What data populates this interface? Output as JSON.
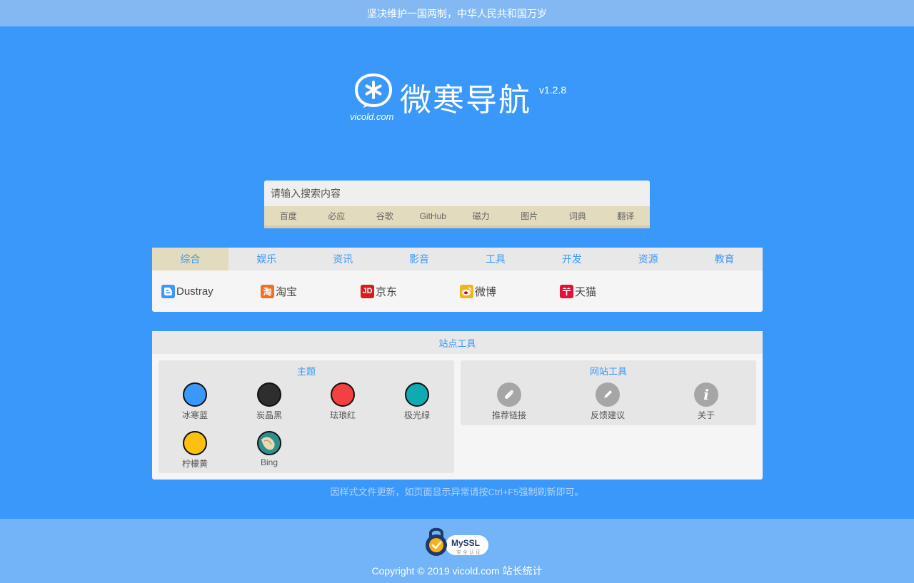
{
  "banner": {
    "text": "坚决维护一国两制，中华人民共和国万岁"
  },
  "logo": {
    "title": "微寒导航",
    "version": "v1.2.8",
    "domain": "vicold.com"
  },
  "search": {
    "placeholder": "请输入搜索内容",
    "engines": [
      "百度",
      "必应",
      "谷歌",
      "GitHub",
      "磁力",
      "图片",
      "词典",
      "翻译"
    ]
  },
  "nav": {
    "tabs": [
      "综合",
      "娱乐",
      "资讯",
      "影音",
      "工具",
      "开发",
      "资源",
      "教育"
    ],
    "active_tab": "综合",
    "sites": [
      {
        "label": "Dustray",
        "icon": "blogger-icon",
        "color": "#3a98fb"
      },
      {
        "label": "淘宝",
        "icon": "taobao-icon",
        "color": "#f07026"
      },
      {
        "label": "京东",
        "icon": "jd-icon",
        "color": "#d71c1e"
      },
      {
        "label": "微博",
        "icon": "weibo-icon",
        "color": "#f2b41c"
      },
      {
        "label": "天猫",
        "icon": "tmall-icon",
        "color": "#e2123a"
      }
    ],
    "site_icon_glyphs": {
      "taobao": "淘",
      "jd": "JD"
    }
  },
  "tools": {
    "title": "站点工具",
    "themes_title": "主题",
    "themes": [
      {
        "label": "冰寒蓝",
        "color": "#3a98fb"
      },
      {
        "label": "炭晶黑",
        "color": "#2e2e2e"
      },
      {
        "label": "珐琅红",
        "color": "#f24140"
      },
      {
        "label": "极光绿",
        "color": "#0eabb3"
      },
      {
        "label": "柠檬黄",
        "color": "#fcc10f"
      },
      {
        "label": "Bing",
        "color": "#2f8f8a"
      }
    ],
    "site_tools_title": "网站工具",
    "site_tools": [
      {
        "label": "推荐链接",
        "icon": "paperclip-icon"
      },
      {
        "label": "反馈建议",
        "icon": "pencil-icon"
      },
      {
        "label": "关于",
        "icon": "info-icon"
      }
    ]
  },
  "notice": "因样式文件更新，如页面显示异常请按Ctrl+F5强制刷新即可。",
  "footer": {
    "ssl_label": "MySSL",
    "ssl_sub": "安全认证",
    "copyright": "Copyright © 2019 vicold.com",
    "stats_link": "站长统计"
  }
}
